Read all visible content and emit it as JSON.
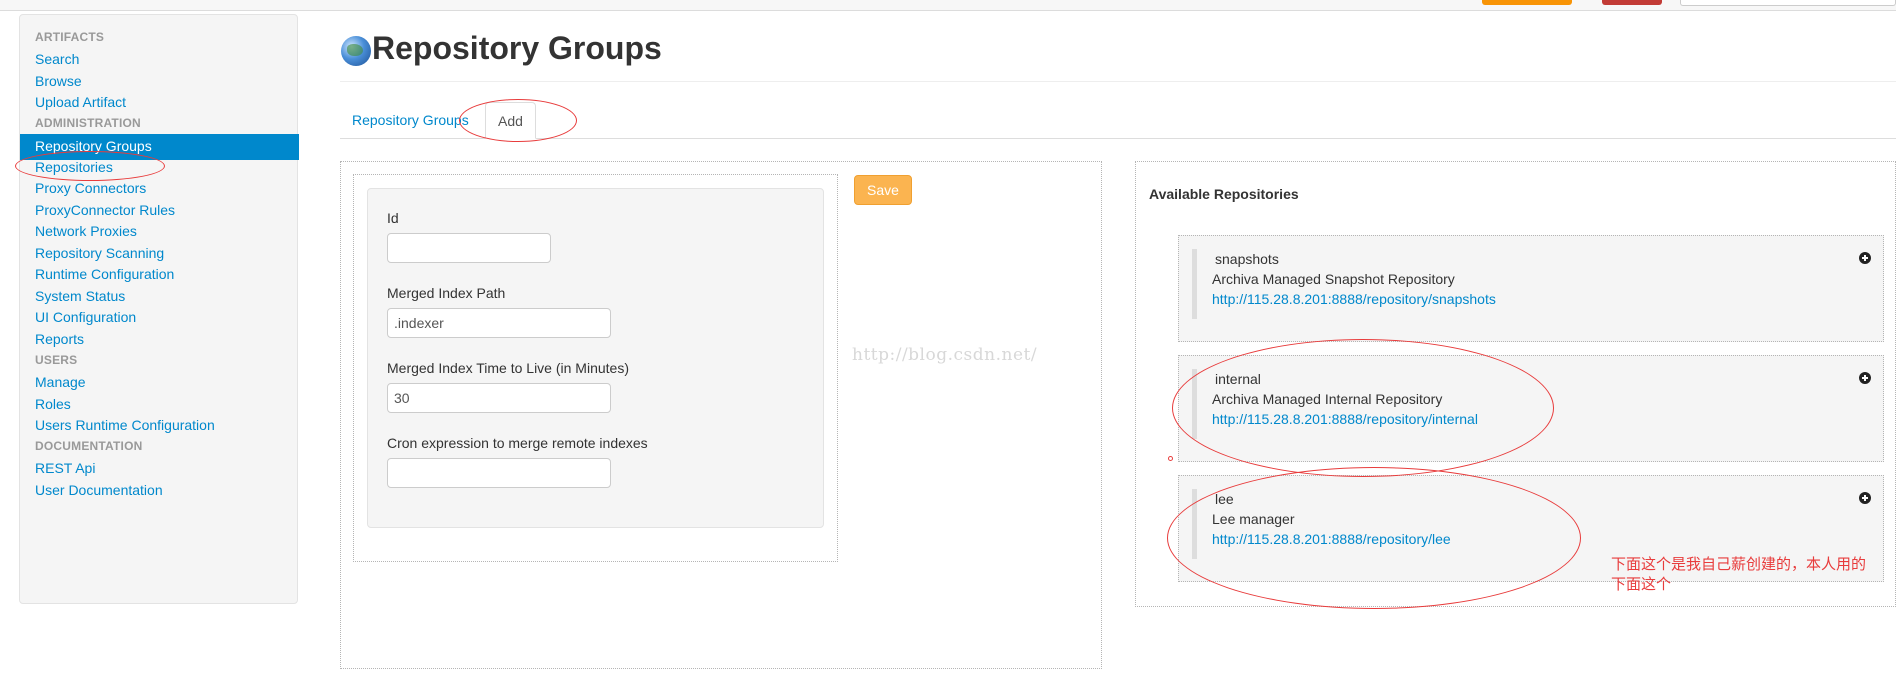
{
  "sidebar": {
    "sections": [
      {
        "header": "ARTIFACTS",
        "items": [
          "Search",
          "Browse",
          "Upload Artifact"
        ]
      },
      {
        "header": "ADMINISTRATION",
        "items": [
          "Repository Groups",
          "Repositories",
          "Proxy Connectors",
          "ProxyConnector Rules",
          "Network Proxies",
          "Repository Scanning",
          "Runtime Configuration",
          "System Status",
          "UI Configuration",
          "Reports"
        ]
      },
      {
        "header": "USERS",
        "items": [
          "Manage",
          "Roles",
          "Users Runtime Configuration"
        ]
      },
      {
        "header": "DOCUMENTATION",
        "items": [
          "REST Api",
          "User Documentation"
        ]
      }
    ],
    "active_item": "Repository Groups"
  },
  "header": {
    "title": "Repository Groups"
  },
  "tabs": [
    {
      "label": "Repository Groups",
      "active": false
    },
    {
      "label": "Add",
      "active": true
    }
  ],
  "form": {
    "id_label": "Id",
    "id_value": "",
    "merged_index_path_label": "Merged Index Path",
    "merged_index_path_value": ".indexer",
    "merged_ttl_label": "Merged Index Time to Live (in Minutes)",
    "merged_ttl_value": "30",
    "cron_label": "Cron expression to merge remote indexes",
    "cron_value": "",
    "save_label": "Save"
  },
  "watermark": "http://blog.csdn.net/",
  "available": {
    "title": "Available Repositories",
    "repos": [
      {
        "id": "snapshots",
        "name": "Archiva Managed Snapshot Repository",
        "url": "http://115.28.8.201:8888/repository/snapshots"
      },
      {
        "id": "internal",
        "name": "Archiva Managed Internal Repository",
        "url": "http://115.28.8.201:8888/repository/internal"
      },
      {
        "id": "lee",
        "name": "Lee manager",
        "url": "http://115.28.8.201:8888/repository/lee"
      }
    ]
  },
  "annotation": {
    "line1": "下面这个是我自己薪创建的，本人用的",
    "line2": "下面这个"
  },
  "colors": {
    "link": "#0088cc",
    "active_bg": "#0088cc",
    "save_btn": "#fbb450",
    "annotation": "#e83c3c"
  }
}
